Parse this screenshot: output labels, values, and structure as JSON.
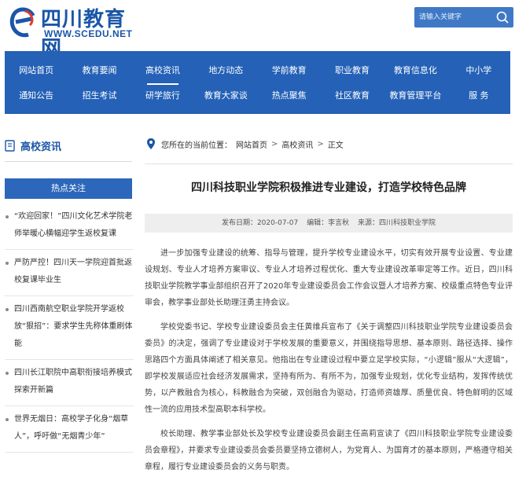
{
  "header": {
    "site_title": "四川教育网",
    "site_url": "WWW.SCEDU.NET",
    "search_placeholder": "请输入关键字"
  },
  "nav": {
    "row1": [
      "网站首页",
      "教育要闻",
      "高校资讯",
      "地方动态",
      "学前教育",
      "职业教育",
      "教育信息化",
      "中小学"
    ],
    "row2": [
      "通知公告",
      "招生考试",
      "研学旅行",
      "教育大家谈",
      "热点聚焦",
      "社区教育",
      "教育管理平台",
      "服 务"
    ],
    "active": "高校资讯"
  },
  "sidebar": {
    "heading": "高校资讯",
    "hot_label": "热点关注",
    "items": [
      "“欢迎回家！”四川文化艺术学院老师举暖心横幅迎学生返校复课",
      "严防严控！四川天一学院迎首批返校复课毕业生",
      "四川西南航空职业学院开学返校放“狠招”：要求学生先称体重刷体能",
      "四川长江职院中高职衔接培养模式探索开新篇",
      "世界无烟日：高校学子化身“烟草人”，呼吁做“无烟青少年”"
    ]
  },
  "breadcrumb": {
    "prefix": "您所在的当前位置：",
    "items": [
      "网站首页",
      "高校资讯",
      "正文"
    ],
    "separator": ">"
  },
  "article": {
    "title": "四川科技职业学院积极推进专业建设，打造学校特色品牌",
    "date": "发布日期：2020-07-07",
    "editor": "编辑：李言秋",
    "source": "来源：四川科技职业学院",
    "paragraphs": [
      "进一步加强专业建设的统筹、指导与管理，提升学校专业建设水平，切实有效开展专业设置、专业建设规划、专业人才培养方案审议、专业人才培养过程优化、重大专业建设改革审定等工作。近日，四川科技职业学院教学事业部组织召开了2020年专业建设委员会工作会议暨人才培养方案、校级重点特色专业评审会，教学事业部处长助理汪勇主持会议。",
      "学校党委书记、学校专业建设委员会主任黄维兵宣布了《关于调整四川科技职业学院专业建设委员会委员》的决定，强调了专业建设对于学校发展的重要意义，并围绕指导思想、基本原则、路径选择、操作思路四个方面具体阐述了相关意见。他指出在专业建设过程中要立足学校实际，“小逻辑”服从“大逻辑”，即学校发展适应社会经济发展需求，坚持有所为、有所不为，加强专业规划，优化专业结构，发挥传统优势，以产教融合为核心，科教融合为突破，双创融合为驱动，打造师资雄厚、质量优良、特色鲜明的区域性一流的应用技术型高职本科学校。",
      "校长助理、教学事业部处长及学校专业建设委员会副主任高莉宣读了《四川科技职业学院专业建设委员会章程》，并要求专业建设委员会委员要坚持立德树人，为党育人、为国育才的基本原则，严格遵守相关章程，履行专业建设委员会的义务与职责。"
    ]
  },
  "colors": {
    "brand_blue": "#1a56a8",
    "nav_blue": "#2461b7",
    "search_blue": "#3f79c6"
  }
}
